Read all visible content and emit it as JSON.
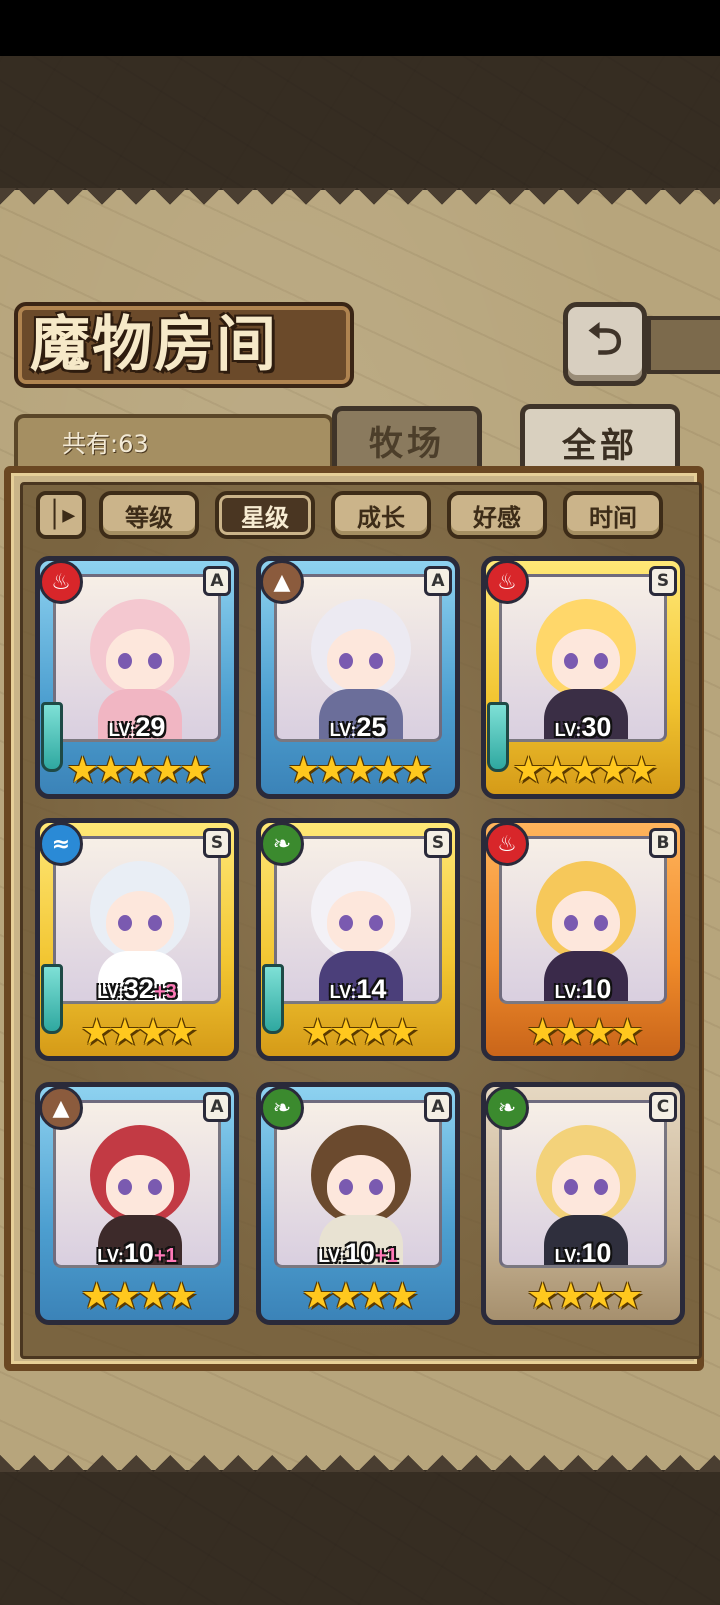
{
  "title": "魔物房间",
  "count_label": "共有:63",
  "tabs": [
    {
      "label": "牧场",
      "active": false
    },
    {
      "label": "全部",
      "active": true
    }
  ],
  "sort": {
    "toggle_icon": "sort-order-icon",
    "buttons": [
      {
        "label": "等级",
        "active": false
      },
      {
        "label": "星级",
        "active": true
      },
      {
        "label": "成长",
        "active": false
      },
      {
        "label": "好感",
        "active": false
      },
      {
        "label": "时间",
        "active": false
      }
    ]
  },
  "lv_prefix": "LV:",
  "monsters": [
    {
      "element": "fire",
      "rank": "A",
      "level": "29",
      "bonus": "",
      "stars": "★★★★★",
      "frame": "blue",
      "weapon": true,
      "colors": {
        "hair": "#f4c8d0",
        "outfit": "#f1b6c3"
      }
    },
    {
      "element": "earth",
      "rank": "A",
      "level": "25",
      "bonus": "",
      "stars": "★★★★★",
      "frame": "blue",
      "weapon": false,
      "colors": {
        "hair": "#eceaf2",
        "outfit": "#6b6e9a"
      }
    },
    {
      "element": "fire",
      "rank": "S",
      "level": "30",
      "bonus": "",
      "stars": "★★★★★",
      "frame": "gold",
      "weapon": true,
      "colors": {
        "hair": "#ffd76a",
        "outfit": "#3a2e45"
      }
    },
    {
      "element": "water",
      "rank": "S",
      "level": "32",
      "bonus": "+3",
      "stars": "★★★★",
      "frame": "gold",
      "weapon": true,
      "colors": {
        "hair": "#e9eef5",
        "outfit": "#ffffff"
      }
    },
    {
      "element": "wind",
      "rank": "S",
      "level": "14",
      "bonus": "",
      "stars": "★★★★",
      "frame": "gold",
      "weapon": true,
      "colors": {
        "hair": "#f3f1f6",
        "outfit": "#4b3f7a"
      }
    },
    {
      "element": "fire",
      "rank": "B",
      "level": "10",
      "bonus": "",
      "stars": "★★★★",
      "frame": "orange",
      "weapon": false,
      "colors": {
        "hair": "#f6c85a",
        "outfit": "#3a2a4a"
      }
    },
    {
      "element": "earth",
      "rank": "A",
      "level": "10",
      "bonus": "+1",
      "stars": "★★★★",
      "frame": "blue",
      "weapon": false,
      "colors": {
        "hair": "#c23a44",
        "outfit": "#3d2a2a"
      }
    },
    {
      "element": "wind",
      "rank": "A",
      "level": "10",
      "bonus": "+1",
      "stars": "★★★★",
      "frame": "blue",
      "weapon": false,
      "colors": {
        "hair": "#6b4a2e",
        "outfit": "#e8e2d2"
      }
    },
    {
      "element": "wind",
      "rank": "C",
      "level": "10",
      "bonus": "",
      "stars": "★★★★",
      "frame": "gray",
      "weapon": false,
      "colors": {
        "hair": "#f3d27a",
        "outfit": "#2f2f3d"
      }
    }
  ]
}
